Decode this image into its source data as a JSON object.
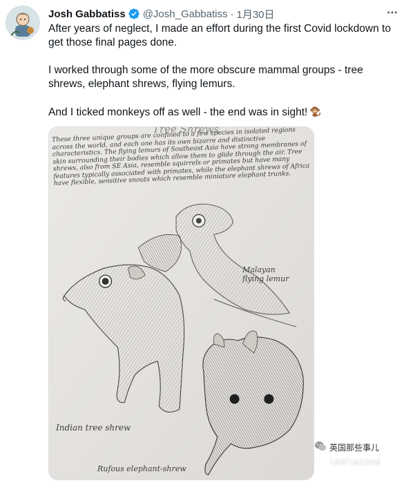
{
  "author": {
    "display_name": "Josh Gabbatiss",
    "handle": "@Josh_Gabbatiss",
    "separator": "·",
    "date": "1月30日"
  },
  "tweet": {
    "paragraphs": [
      "After years of neglect, I made an effort during the first Covid lockdown to get those final pages done.",
      "I worked through some of the more obscure mammal groups - tree shrews, elephant shrews, flying lemurs.",
      "And I ticked monkeys off as well - the end was in sight!"
    ],
    "emoji_icon": "monkey-emoji-icon"
  },
  "media": {
    "sketch_heading": "Tree Shrews",
    "sketch_paragraph": "These three unique groups are confined to a few species in isolated regions across the world, and each one has its own bizarre and distinctive characteristics. The flying lemurs of Southeast Asia have strong membranes of skin surrounding their bodies which allow them to glide through the air. Tree shrews, also from SE Asia, resemble squirrels or primates but have many features typically associated with primates, while the elephant shrews of Africa have flexible, sensitive snouts which resemble miniature elephant trunks.",
    "label_flying_lemur": "Malayan flying lemur",
    "label_tree_shrew": "Indian tree shrew",
    "label_elephant_shrew": "Rufous elephant-shrew"
  },
  "watermark": {
    "text": "英国那些事儿",
    "sub": "UnFrazone"
  },
  "colors": {
    "text_primary": "#0f1419",
    "text_secondary": "#536471",
    "verified_blue": "#1d9bf0",
    "paper": "#e8e6e3"
  }
}
